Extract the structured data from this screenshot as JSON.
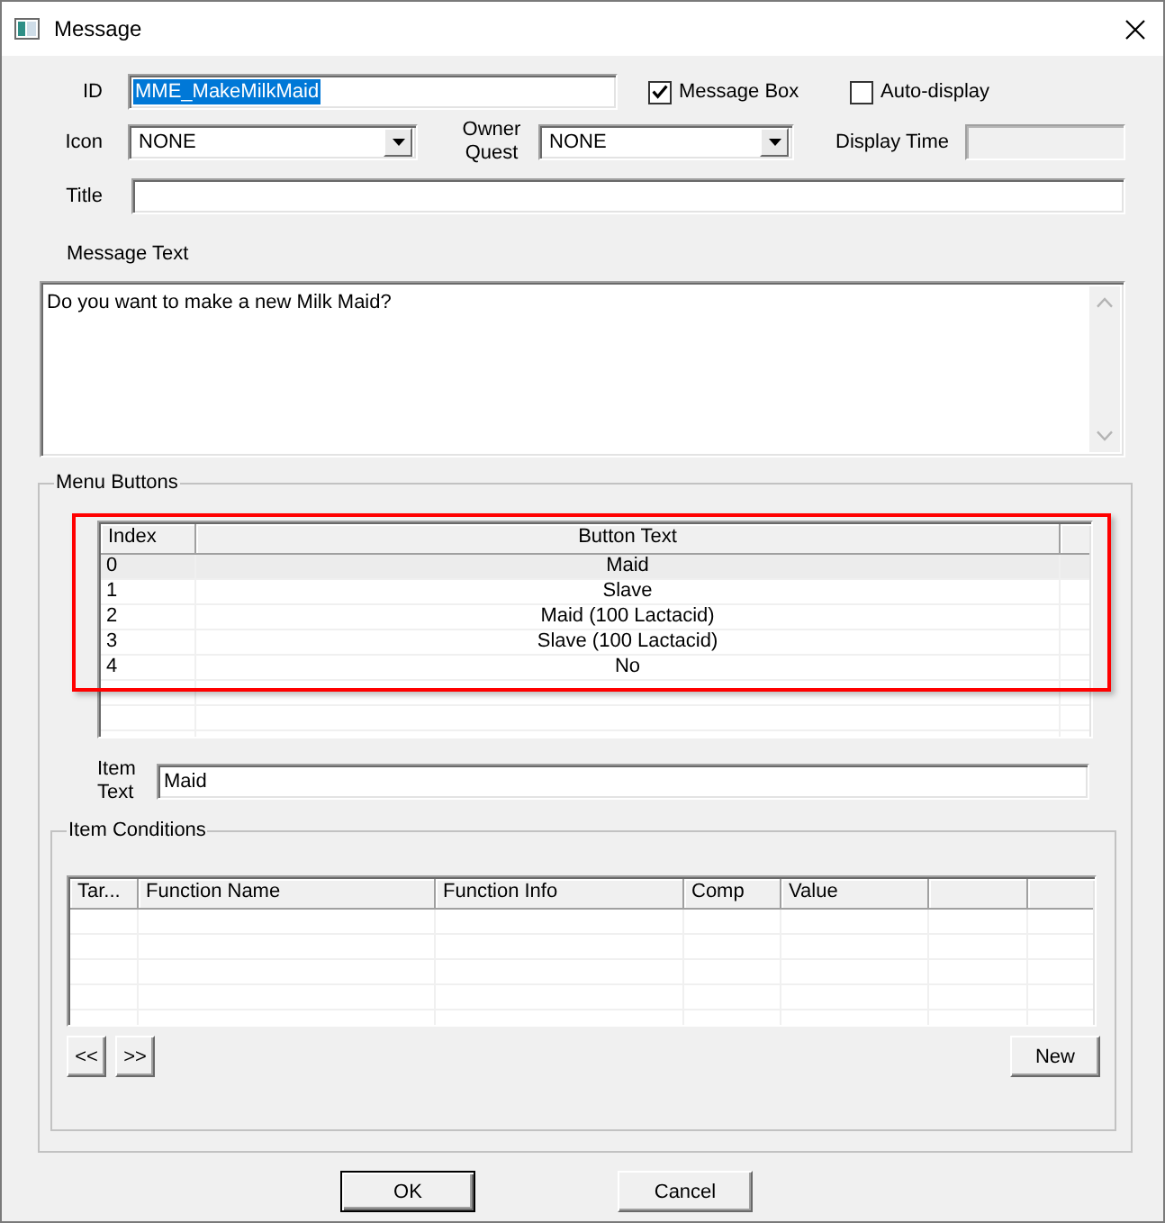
{
  "window": {
    "title": "Message"
  },
  "form": {
    "id": {
      "label": "ID",
      "value": "MME_MakeMilkMaid",
      "text_selected": true
    },
    "message_box": {
      "label": "Message Box",
      "checked": true
    },
    "auto_display": {
      "label": "Auto-display",
      "checked": false
    },
    "icon": {
      "label": "Icon",
      "value": "NONE"
    },
    "owner_quest": {
      "label": "Owner Quest",
      "value": "NONE"
    },
    "display_time": {
      "label": "Display Time",
      "disabled": true
    },
    "title": {
      "label": "Title"
    },
    "message_text": {
      "label": "Message Text",
      "value": "Do you want to make a new Milk Maid?"
    }
  },
  "menu_buttons": {
    "legend": "Menu Buttons",
    "columns": [
      "Index",
      "Button Text"
    ],
    "rows": [
      {
        "index": "0",
        "text": "Maid",
        "selected": true
      },
      {
        "index": "1",
        "text": "Slave",
        "selected": false
      },
      {
        "index": "2",
        "text": "Maid (100 Lactacid)",
        "selected": false
      },
      {
        "index": "3",
        "text": "Slave (100 Lactacid)",
        "selected": false
      },
      {
        "index": "4",
        "text": "No",
        "selected": false
      }
    ],
    "annotation": {
      "kind": "outline"
    },
    "item_text": {
      "label": "Item Text",
      "value": "Maid"
    }
  },
  "item_conditions": {
    "legend": "Item Conditions",
    "columns": [
      "Tar...",
      "Function Name",
      "Function Info",
      "Comp",
      "Value"
    ],
    "prev_button": "<<",
    "next_button": ">>",
    "new_button": "New"
  },
  "buttons": [
    {
      "label": "OK",
      "default": true
    },
    {
      "label": "Cancel",
      "default": false
    }
  ]
}
